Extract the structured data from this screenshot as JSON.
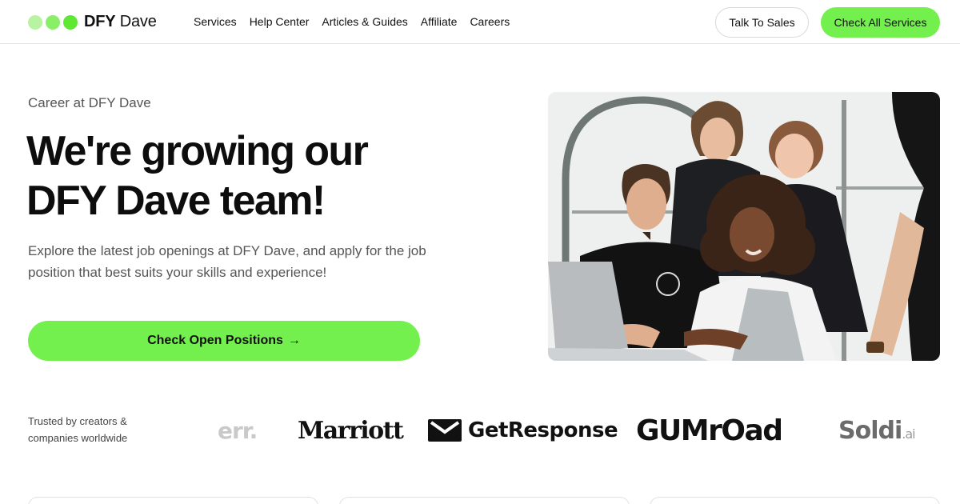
{
  "header": {
    "logo": {
      "bold": "DFY",
      "regular": "Dave",
      "dot_colors": [
        "#b7f3a0",
        "#8aee67",
        "#5fe832"
      ]
    },
    "nav": [
      "Services",
      "Help Center",
      "Articles & Guides",
      "Affiliate",
      "Careers"
    ],
    "talk_to_sales": "Talk To Sales",
    "check_all_services": "Check All Services"
  },
  "hero": {
    "eyebrow": "Career at DFY Dave",
    "headline_line1": "We're growing our",
    "headline_line2": "DFY Dave team!",
    "description": "Explore the latest job openings at DFY Dave, and apply for the job position that best suits your skills and experience!",
    "cta": "Check Open Positions",
    "cta_arrow": "→"
  },
  "trusted": {
    "label": "Trusted by creators & companies worldwide",
    "brands": [
      {
        "name": "err.",
        "style": "faded"
      },
      {
        "name": "Marriott",
        "style": "serif"
      },
      {
        "name": "GetResponse",
        "style": "icon"
      },
      {
        "name": "GUMrOad",
        "style": "wide"
      },
      {
        "name": "Soldi",
        "suffix": ".ai",
        "style": "faded"
      }
    ]
  },
  "colors": {
    "accent_green": "#73f04e",
    "text_dark": "#0d0d0d",
    "text_muted": "#555555"
  }
}
